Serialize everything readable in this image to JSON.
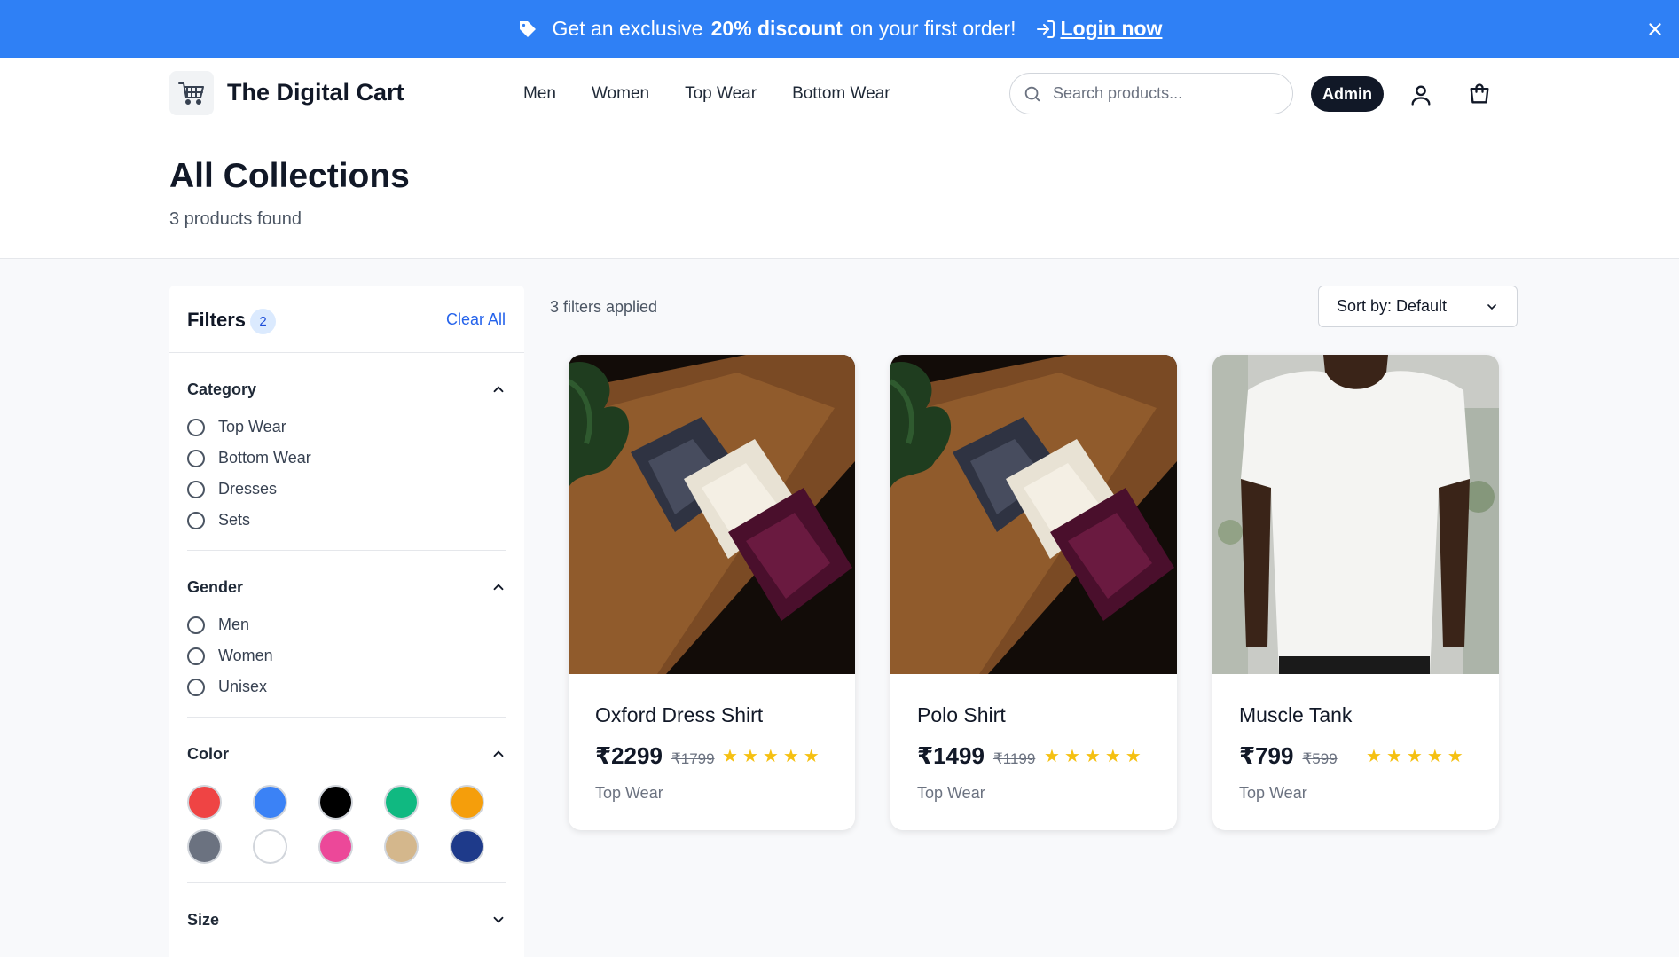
{
  "promo": {
    "text_before": "Get an exclusive",
    "highlight": "20% discount",
    "text_after": "on your first order!",
    "login_label": "Login now"
  },
  "header": {
    "brand": "The Digital Cart",
    "nav": [
      "Men",
      "Women",
      "Top Wear",
      "Bottom Wear"
    ],
    "search_placeholder": "Search products...",
    "admin_label": "Admin"
  },
  "page": {
    "title": "All Collections",
    "count": "3 products found"
  },
  "filters": {
    "title": "Filters",
    "badge": "2",
    "clear_label": "Clear All",
    "category": {
      "title": "Category",
      "options": [
        "Top Wear",
        "Bottom Wear",
        "Dresses",
        "Sets"
      ]
    },
    "gender": {
      "title": "Gender",
      "options": [
        "Men",
        "Women",
        "Unisex"
      ]
    },
    "color": {
      "title": "Color",
      "swatches": [
        "#ef4444",
        "#3b82f6",
        "#000000",
        "#10b981",
        "#f59e0b",
        "#6b7280",
        "#ffffff",
        "#ec4899",
        "#d4b78c",
        "#1e3a8a"
      ]
    },
    "size": {
      "title": "Size"
    }
  },
  "toolbar": {
    "applied": "3 filters applied",
    "sort_label": "Sort by: Default"
  },
  "products": [
    {
      "name": "Oxford Dress Shirt",
      "price": "₹2299",
      "old_price": "₹1799",
      "rating": 5,
      "category": "Top Wear"
    },
    {
      "name": "Polo Shirt",
      "price": "₹1499",
      "old_price": "₹1199",
      "rating": 5,
      "category": "Top Wear"
    },
    {
      "name": "Muscle Tank",
      "price": "₹799",
      "old_price": "₹599",
      "rating": 5,
      "category": "Top Wear"
    }
  ]
}
